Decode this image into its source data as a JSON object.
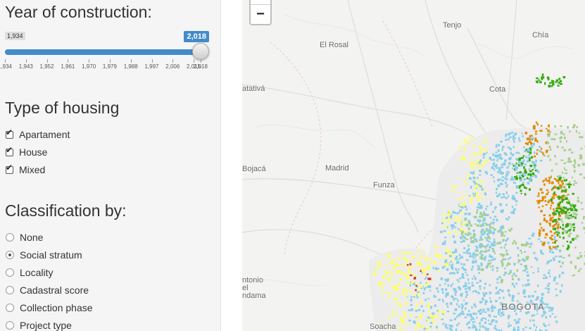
{
  "sidebar": {
    "year_title": "Year of construction:",
    "slider": {
      "min_label": "1,934",
      "max_label": "2,018",
      "min": 1934,
      "max": 2018,
      "selected_from": 1934,
      "selected_to": 2018,
      "ticks": [
        "1,934",
        "1,943",
        "1,952",
        "1,961",
        "1,970",
        "1,979",
        "1,988",
        "1,997",
        "2,006",
        "2,015",
        "2,018"
      ],
      "tick_values": [
        1934,
        1943,
        1952,
        1961,
        1970,
        1979,
        1988,
        1997,
        2006,
        2015,
        2018
      ]
    },
    "housing_title": "Type of housing",
    "housing_options": [
      {
        "label": "Apartament",
        "checked": true
      },
      {
        "label": "House",
        "checked": true
      },
      {
        "label": "Mixed",
        "checked": true
      }
    ],
    "classification_title": "Classification by:",
    "classification_options": [
      {
        "label": "None",
        "selected": false
      },
      {
        "label": "Social stratum",
        "selected": true
      },
      {
        "label": "Locality",
        "selected": false
      },
      {
        "label": "Cadastral score",
        "selected": false
      },
      {
        "label": "Collection phase",
        "selected": false
      },
      {
        "label": "Project type",
        "selected": false
      }
    ]
  },
  "map": {
    "zoom_out_label": "−",
    "places": {
      "tenjo": "Tenjo",
      "chia": "Chía",
      "el_rosal": "El Rosal",
      "cota": "Cota",
      "facatativa": "atativá",
      "bojaca": "Bojacá",
      "madrid": "Madrid",
      "funza": "Funza",
      "antonio_1": "ntonio",
      "antonio_2": "el",
      "antonio_3": "ndama",
      "bogota": "BOGOTA",
      "soacha": "Soacha"
    },
    "colors": {
      "stratum_1": "#d7301f",
      "stratum_2": "#ffff66",
      "stratum_3": "#87ceeb",
      "stratum_4": "#a6cf8a",
      "stratum_5": "#e08a00",
      "stratum_6": "#33aa11"
    }
  }
}
